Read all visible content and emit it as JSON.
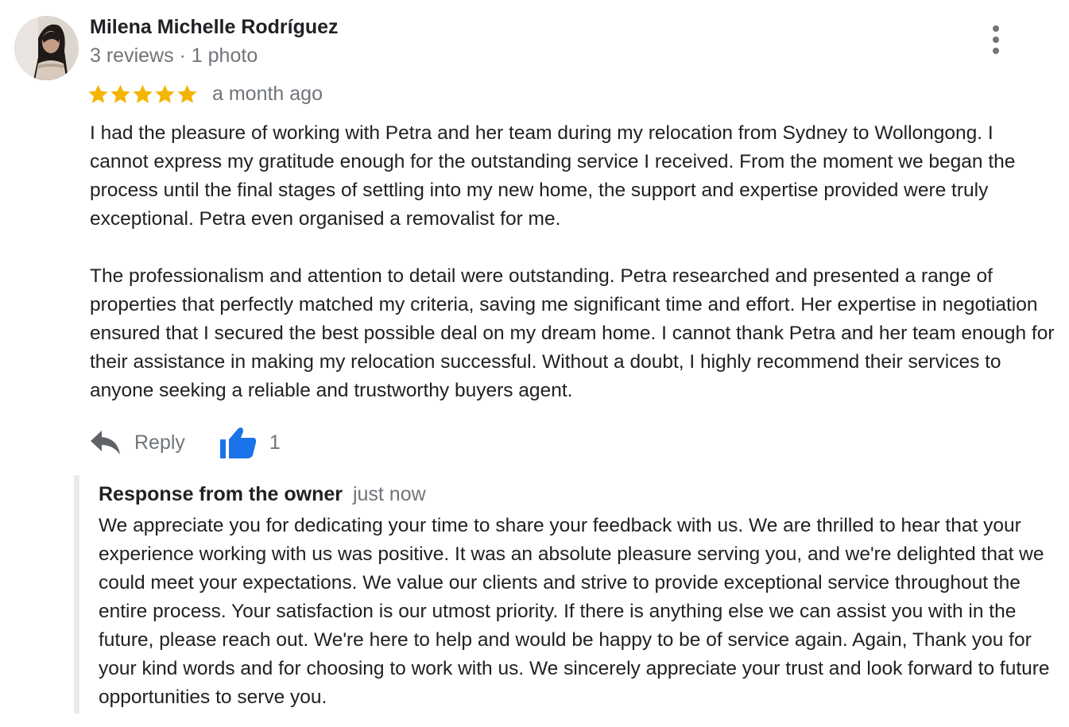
{
  "review": {
    "author": {
      "name": "Milena Michelle Rodríguez",
      "meta": "3 reviews · 1 photo"
    },
    "rating": 5,
    "time_ago": "a month ago",
    "paragraphs": [
      "I had the pleasure of working with Petra and her team during my relocation from Sydney to Wollongong. I cannot express my gratitude enough for the outstanding service I received. From the moment we began the process until the final stages of settling into my new home, the support and expertise provided were truly exceptional. Petra even organised a removalist for me.",
      "The professionalism and attention to detail were outstanding. Petra researched and presented a range of properties that perfectly matched my criteria, saving me significant time and effort. Her expertise in negotiation ensured that I secured the best possible deal on my dream home. I cannot thank Petra and her team enough for their assistance in making my relocation successful. Without a doubt, I highly recommend their services to anyone seeking a reliable and trustworthy buyers agent."
    ],
    "actions": {
      "reply_label": "Reply",
      "like_count": "1"
    },
    "owner_response": {
      "label": "Response from the owner",
      "time": "just now",
      "text": "We appreciate you for dedicating your time to share your feedback with us. We are thrilled to hear that your experience working with us was positive. It was an absolute pleasure serving you, and we're delighted that we could meet your expectations. We value our clients and strive to provide exceptional service throughout the entire process. Your satisfaction is our utmost priority. If there is anything else we can assist you with in the future, please reach out. We're here to help and would be happy to be of service again. Again, Thank you for your kind words and for choosing to work with us. We sincerely appreciate your trust and look forward to future opportunities to serve you."
    }
  },
  "colors": {
    "star": "#f4b400",
    "like_icon": "#1a73e8",
    "secondary_text": "#70757a",
    "primary_text": "#202124",
    "response_border": "#e8eaed"
  },
  "icons": {
    "more": "more-vert-icon",
    "reply": "reply-arrow-icon",
    "like": "thumb-up-icon",
    "star": "star-icon"
  }
}
